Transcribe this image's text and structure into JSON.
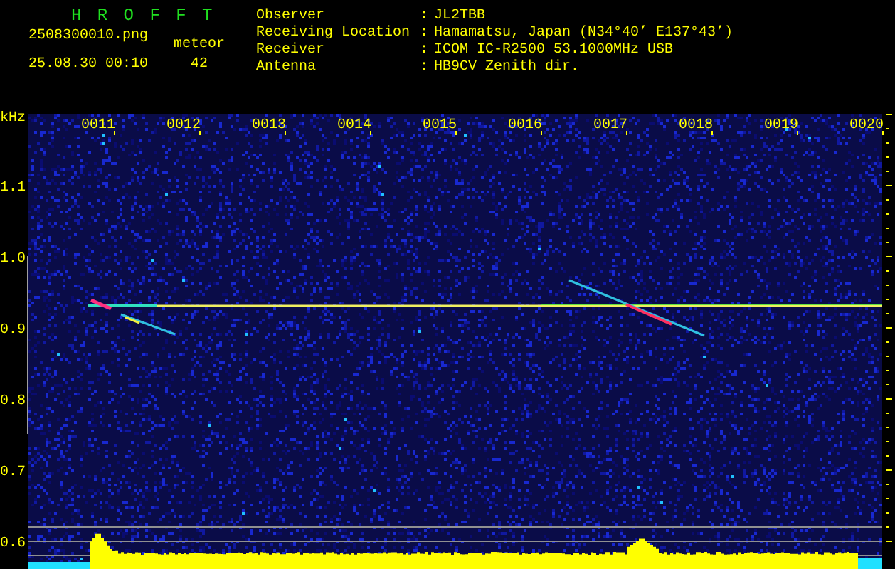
{
  "header": {
    "title": "H R O F F T",
    "filename": "2508300010.png",
    "datetime": "25.08.30 00:10",
    "counter_label": "meteor",
    "counter_value": "42"
  },
  "station": [
    {
      "label": "Observer",
      "separator": ":",
      "value": "JL2TBB"
    },
    {
      "label": "Receiving Location",
      "separator": ":",
      "value": "Hamamatsu, Japan (N34°40’ E137°43’)"
    },
    {
      "label": "Receiver",
      "separator": ":",
      "value": "ICOM IC-R2500 53.1000MHz USB"
    },
    {
      "label": "Antenna",
      "separator": ":",
      "value": "HB9CV Zenith dir."
    }
  ],
  "plot": {
    "unit": "kHz",
    "time_labels": [
      "0011",
      "0012",
      "0013",
      "0014",
      "0015",
      "0016",
      "0017",
      "0018",
      "0019",
      "0020"
    ],
    "freq_labels": [
      "1.1",
      "1.0",
      "0.9",
      "0.8",
      "0.7",
      "0.6"
    ]
  }
}
